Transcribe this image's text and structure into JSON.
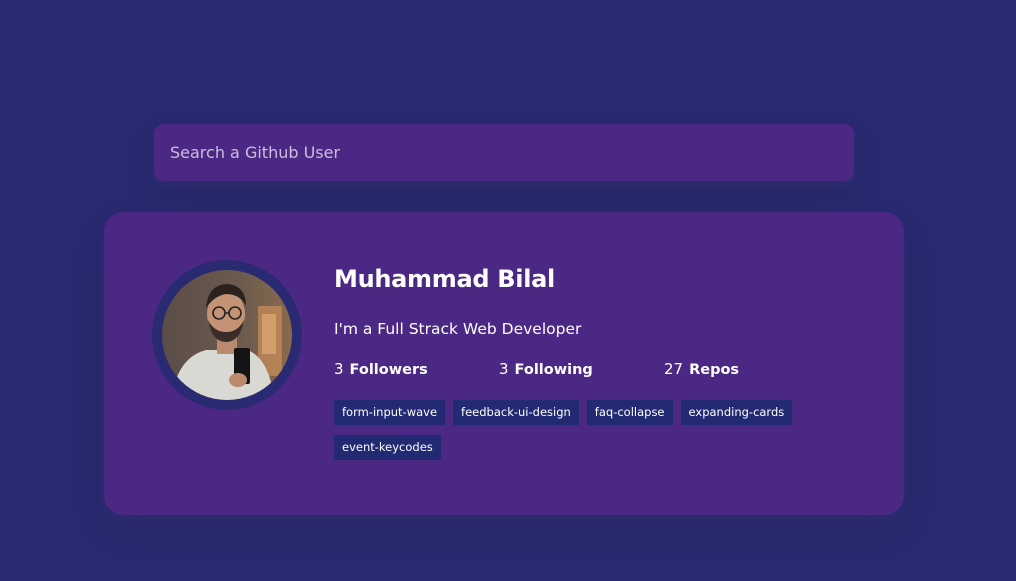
{
  "search": {
    "placeholder": "Search a Github User"
  },
  "user": {
    "name": "Muhammad Bilal",
    "bio": "I'm a Full Strack Web Developer",
    "avatar_icon": "user-avatar-photo"
  },
  "stats": [
    {
      "count": "3",
      "label": "Followers"
    },
    {
      "count": "3",
      "label": "Following"
    },
    {
      "count": "27",
      "label": "Repos"
    }
  ],
  "repos": [
    "form-input-wave",
    "feedback-ui-design",
    "faq-collapse",
    "expanding-cards",
    "event-keycodes"
  ],
  "colors": {
    "background": "#2a2a72",
    "card": "#4c2885",
    "repo_tag": "#212a72",
    "text": "#ffffff"
  }
}
